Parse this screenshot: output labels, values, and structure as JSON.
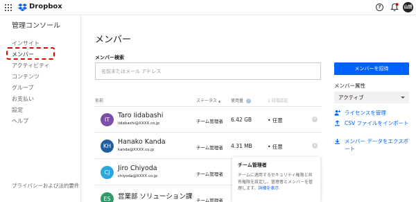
{
  "app": {
    "logo_text": "Dropbox",
    "avatar_initials": "山田",
    "help_glyph": "?",
    "accent_color": "#0061fe"
  },
  "sidebar": {
    "title": "管理コンソール",
    "items": [
      {
        "label": "インサイト"
      },
      {
        "label": "メンバー"
      },
      {
        "label": "アクティビティ"
      },
      {
        "label": "コンテンツ"
      },
      {
        "label": "グループ"
      },
      {
        "label": "お支払い"
      },
      {
        "label": "設定"
      },
      {
        "label": "ヘルプ"
      }
    ],
    "footer": "プライバシーおよび法的要件"
  },
  "main": {
    "title": "メンバー",
    "search_label": "メンバー検索",
    "search_placeholder": "名前またはメール アドレス",
    "invite_button": "メンバーを招待",
    "attribute_label": "メンバー属性",
    "attribute_value": "アクティブ",
    "links": [
      {
        "label": "ライセンスを管理",
        "icon": "person-add-icon"
      },
      {
        "label": "CSV ファイルをインポート",
        "icon": "upload-icon"
      },
      {
        "label": "メンバー データをエクスポート",
        "icon": "download-icon"
      }
    ],
    "table": {
      "headers": {
        "name": "名前",
        "status": "ステータス",
        "status_sort": "▲",
        "usage": "使用量",
        "usage_info": "i",
        "two_factor": "2 段階認証"
      },
      "rows": [
        {
          "initials": "IT",
          "color": "#7b4fa8",
          "name": "Taro Iidabashi",
          "email": "iidabashi@XXXX.co.jp",
          "status": "チーム管理者",
          "usage": "6.42 GB",
          "two_factor": "• 任意",
          "remove": "×"
        },
        {
          "initials": "KH",
          "color": "#1f5f9e",
          "name": "Hanako Kanda",
          "email": "kanda@XXXX.co.jp",
          "status": "チーム管理者",
          "usage": "4.31 MB",
          "two_factor": "• 任意",
          "remove": "×"
        },
        {
          "initials": "CJ",
          "color": "#2aa7df",
          "name": "Jiro Chiyoda",
          "email": "chiyoda@XXXX.co.jp",
          "status": "チーム管理者",
          "usage": "",
          "two_factor": "",
          "remove": ""
        },
        {
          "initials": "ES",
          "color": "#2e9a6a",
          "name": "営業部 ソリューション課",
          "email": "",
          "status": "チーム管理者",
          "usage": "",
          "two_factor": "",
          "remove": ""
        }
      ]
    },
    "tooltip": {
      "title": "チーム管理者",
      "body": "チームに適用するセキュリティ権限と共有権限を設定し、管理者とメンバーを管理します。",
      "link": "詳細を表示"
    }
  }
}
